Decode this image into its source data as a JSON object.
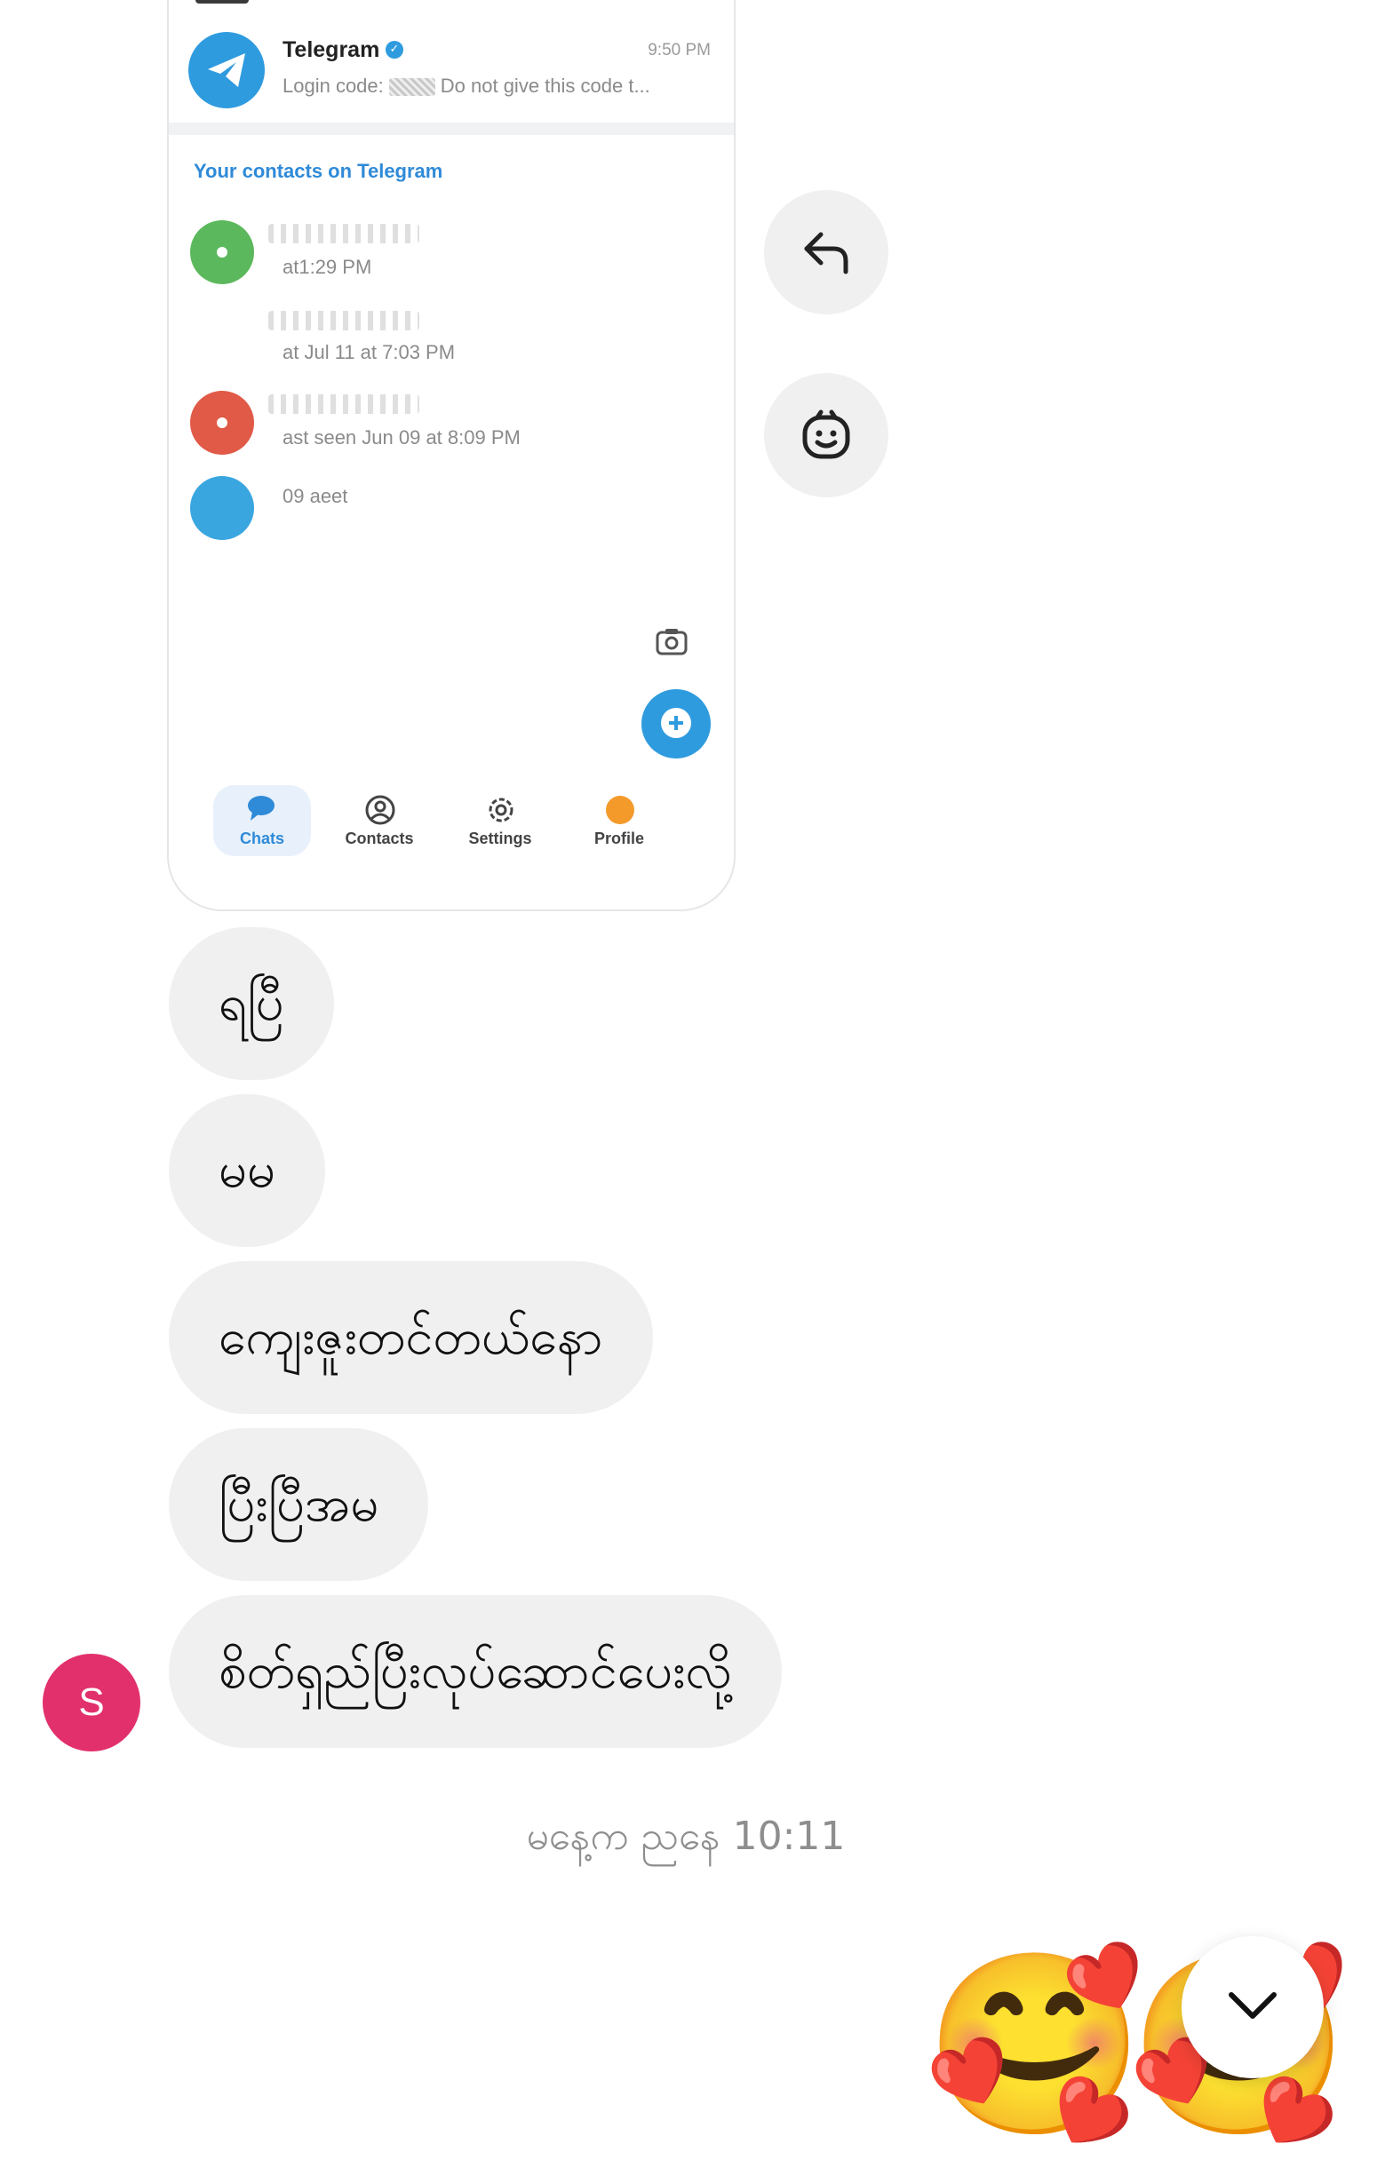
{
  "shared_screenshot": {
    "telegram_row": {
      "name": "Telegram",
      "time": "9:50 PM",
      "preview_prefix": "Login code:",
      "preview_suffix": "Do not give this code t..."
    },
    "contacts_title": "Your contacts on Telegram",
    "contacts": [
      {
        "status": "at1:29 PM",
        "color": "#5cb85c"
      },
      {
        "status": "at Jul 11 at 7:03 PM",
        "color": "#ffffff"
      },
      {
        "status": "ast seen Jun 09 at 8:09 PM",
        "color": "#e05a47"
      },
      {
        "status": "09 aeet",
        "color": "#3aa6e0"
      }
    ],
    "tabs": [
      {
        "label": "Chats",
        "icon": "chat-bubbles-icon",
        "active": true
      },
      {
        "label": "Contacts",
        "icon": "user-circle-icon",
        "active": false
      },
      {
        "label": "Settings",
        "icon": "gear-icon",
        "active": false
      },
      {
        "label": "Profile",
        "icon": "profile-avatar-icon",
        "active": false
      }
    ]
  },
  "side_actions": [
    {
      "icon": "reply-icon"
    },
    {
      "icon": "emoji-react-icon"
    }
  ],
  "messages": [
    {
      "text": "ရပြီ"
    },
    {
      "text": "မမ"
    },
    {
      "text": "ကျေးဇူးတင်တယ်နော"
    },
    {
      "text": "ပြီးပြီအမ"
    },
    {
      "text": "စိတ်ရှည်ပြီးလုပ်ဆောင်ပေးလို့"
    }
  ],
  "sender": {
    "initial": "S",
    "color": "#e2306c"
  },
  "timestamp": "မနေ့က ညနေ 10:11",
  "reactions": [
    {
      "emoji": "🥰"
    },
    {
      "emoji": "🥰"
    }
  ],
  "scroll_button": {
    "icon": "chevron-down-icon"
  }
}
